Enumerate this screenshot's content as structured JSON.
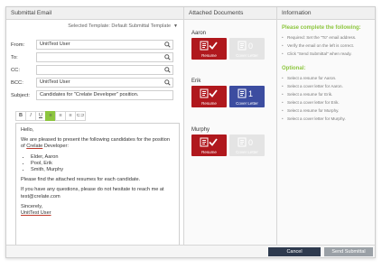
{
  "email": {
    "header": "Submittal Email",
    "template_label": "Selected Template: Default Submittal Template",
    "fields": {
      "from_label": "From:",
      "from_value": "UnitTest User",
      "to_label": "To:",
      "to_value": "",
      "cc_label": "CC:",
      "cc_value": "",
      "bcc_label": "BCC:",
      "bcc_value": "UnitTest User",
      "subject_label": "Subject:",
      "subject_value": "Candidates for \"Crelate Developer\" position."
    },
    "toolbar": [
      "B",
      "I",
      "U",
      "≡",
      "≡",
      "≡",
      "⊂⊃"
    ],
    "body": {
      "greeting": "Hello,",
      "intro_a": "We are pleased to present the following candidates for the position of ",
      "intro_u": "Crelate",
      "intro_b": " Developer:",
      "candidates": [
        "Elder, Aaron",
        "Pool, Erik",
        "Smith, Murphy"
      ],
      "attached": "Please find the attached resumes for each candidate.",
      "questions": "If you have any questions, please do not hesitate to reach me at test@crelate.com",
      "closing": "Sincerely,",
      "signature": "UnitTest User"
    }
  },
  "docs": {
    "header": "Attached Documents",
    "candidates": [
      {
        "name": "Aaron",
        "resume": "Resume",
        "cover": "Cover Letter",
        "cover_count": "0"
      },
      {
        "name": "Erik",
        "resume": "Resume",
        "cover": "Cover Letter",
        "cover_count": "1"
      },
      {
        "name": "Murphy",
        "resume": "Resume",
        "cover": "Cover Letter",
        "cover_count": "0"
      }
    ]
  },
  "info": {
    "header": "Information",
    "complete_title": "Please complete the following:",
    "complete_items": [
      "Required: Set the \"To\" email address.",
      "Verify the email on the left is correct.",
      "Click \"Send Submittal\" when ready."
    ],
    "optional_title": "Optional:",
    "optional_items": [
      "Select a resume for Aaron.",
      "Select a cover letter for Aaron.",
      "Select a resume for Erik.",
      "Select a cover letter for Erik.",
      "Select a resume for Murphy.",
      "Select a cover letter for Murphy."
    ]
  },
  "footer": {
    "cancel": "Cancel",
    "send": "Send Submittal"
  },
  "colors": {
    "accent_green": "#8dc63f",
    "resume_red": "#b0181d",
    "cover_blue": "#3c4da0",
    "cancel_navy": "#2e3a4e"
  }
}
